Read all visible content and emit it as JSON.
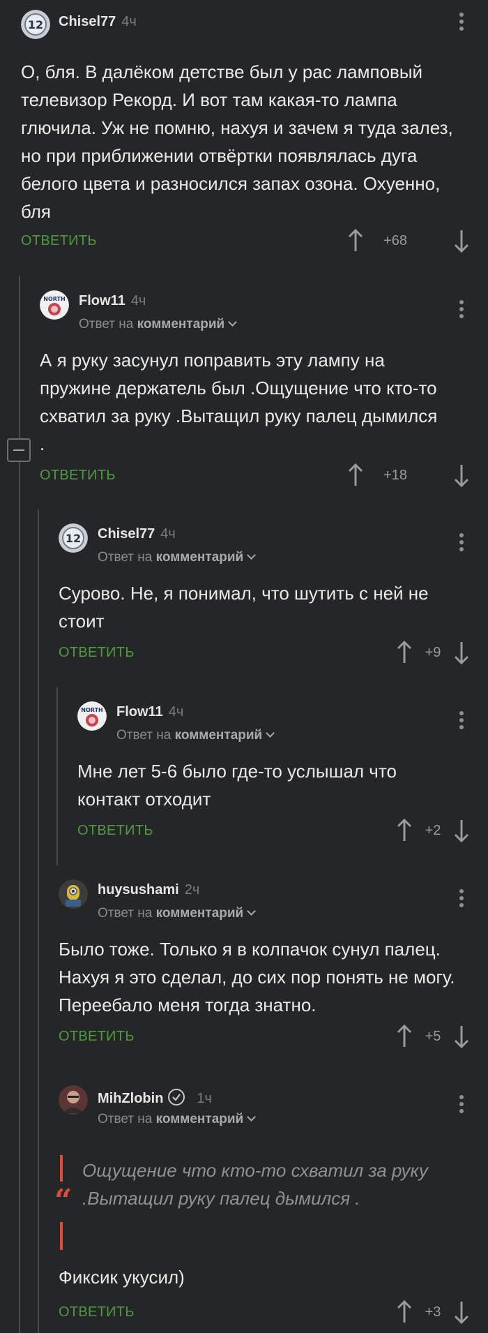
{
  "comments": [
    {
      "author": "Chisel77",
      "time": "4ч",
      "reply_prefix": "",
      "reply_target": "",
      "text": "О, бля. В далёком детстве был у рас ламповый телевизор Рекорд. И вот там какая-то лампа глючила. Уж не помню, нахуя и зачем я туда залез, но при приближении отвёртки появлялась дуга белого цвета и разносился запах озона. Охуенно, бля",
      "reply_label": "ОТВЕТИТЬ",
      "rating": "+68"
    },
    {
      "author": "Flow11",
      "time": "4ч",
      "reply_prefix": "Ответ на",
      "reply_target": "комментарий",
      "text": "А я руку засунул поправить эту лампу на пружине держатель был .Ощущение что кто-то схватил за руку .Вытащил руку палец дымился .",
      "reply_label": "ОТВЕТИТЬ",
      "rating": "+18"
    },
    {
      "author": "Chisel77",
      "time": "4ч",
      "reply_prefix": "Ответ на",
      "reply_target": "комментарий",
      "text": "Сурово. Не, я понимал, что шутить с ней не стоит",
      "reply_label": "ОТВЕТИТЬ",
      "rating": "+9"
    },
    {
      "author": "Flow11",
      "time": "4ч",
      "reply_prefix": "Ответ на",
      "reply_target": "комментарий",
      "text": "Мне лет 5-6 было где-то услышал что контакт отходит",
      "reply_label": "ОТВЕТИТЬ",
      "rating": "+2"
    },
    {
      "author": "huysushami",
      "time": "2ч",
      "reply_prefix": "Ответ на",
      "reply_target": "комментарий",
      "text": "Было тоже. Только я в колпачок сунул палец. Нахуя я это сделал, до сих пор понять не могу. Переебало меня тогда знатно.",
      "reply_label": "ОТВЕТИТЬ",
      "rating": "+5"
    },
    {
      "author": "MihZlobin",
      "time": "1ч",
      "reply_prefix": "Ответ на",
      "reply_target": "комментарий",
      "quote": "Ощущение что кто-то схватил за руку .Вытащил руку палец дымился .",
      "text": "Фиксик укусил)",
      "reply_label": "ОТВЕТИТЬ",
      "rating": "+3"
    }
  ],
  "colors": {
    "background": "#252628",
    "reply": "#4f9a3f",
    "quote_bar": "#e04a3c"
  }
}
